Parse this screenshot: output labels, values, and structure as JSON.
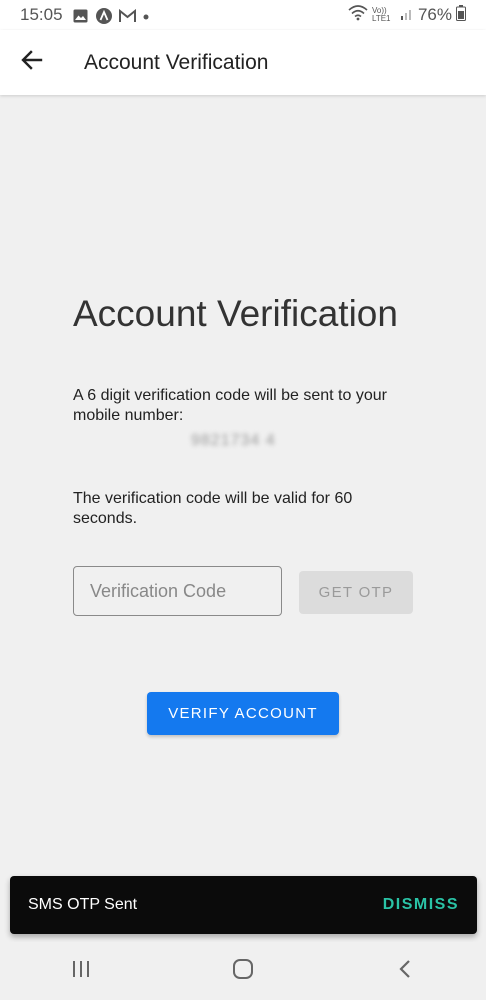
{
  "status_bar": {
    "time": "15:05",
    "network_label": "Vo)) LTE1",
    "battery": "76%",
    "icons_left": [
      "image-icon",
      "app-a-icon",
      "gmail-icon",
      "dot-icon"
    ],
    "icons_right": [
      "wifi-icon",
      "lte-icon",
      "signal-icon",
      "battery-icon"
    ]
  },
  "app_bar": {
    "back_icon": "arrow-left-icon",
    "title": "Account Verification"
  },
  "main": {
    "heading": "Account Verification",
    "info": "A 6 digit verification code will be sent to your mobile number:",
    "phone_masked": "9821734 4",
    "validity": "The verification code will be valid for 60 seconds."
  },
  "form": {
    "code_placeholder": "Verification Code",
    "code_value": "",
    "get_otp_label": "GET OTP",
    "verify_label": "VERIFY ACCOUNT"
  },
  "snackbar": {
    "message": "SMS OTP Sent",
    "action": "DISMISS"
  },
  "nav_bar": {
    "icons": [
      "recent-apps-icon",
      "home-icon",
      "back-icon"
    ]
  },
  "colors": {
    "primary": "#1479ef",
    "accent": "#2ac3a6",
    "background": "#f0f0f0",
    "snackbar": "#0b0b0b",
    "disabled_button": "#dcdcdc"
  }
}
